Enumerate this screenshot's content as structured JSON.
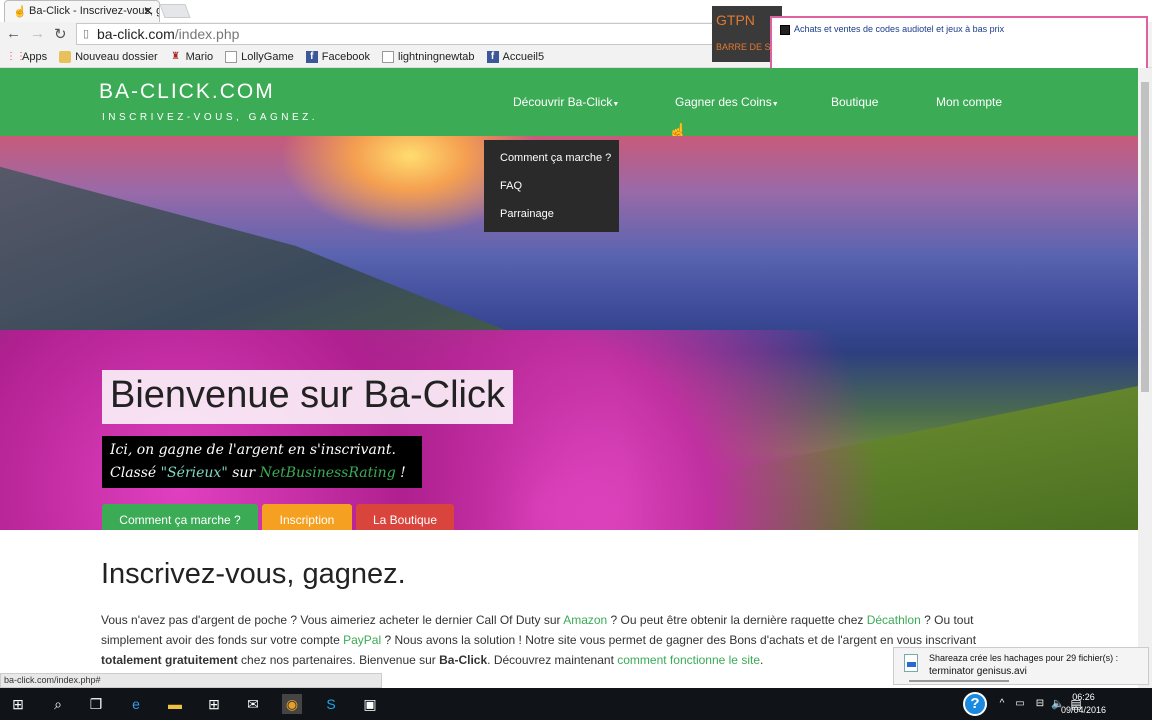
{
  "browser": {
    "tab_title": "Ba-Click - Inscrivez-vous, g",
    "url_domain": "ba-click.com",
    "url_path": "/index.php",
    "bookmarks": [
      "Apps",
      "Nouveau dossier",
      "Mario",
      "LollyGame",
      "Facebook",
      "lightningnewtab",
      "Accueil5"
    ]
  },
  "popup": {
    "side_title": "GTPN",
    "side_sub": "BARRE DE S",
    "message": "Achats et ventes de codes audiotel et jeux à bas prix"
  },
  "site": {
    "brand": "BA-CLICK.COM",
    "tagline": "INSCRIVEZ-VOUS, GAGNEZ.",
    "nav": [
      "Découvrir Ba-Click",
      "Gagner des Coins",
      "Boutique",
      "Mon compte"
    ],
    "dropdown": [
      "Comment ça marche ?",
      "FAQ",
      "Parrainage"
    ],
    "hero": {
      "title": "Bienvenue sur Ba-Click",
      "line1": "Ici, on gagne de l'argent en s'inscrivant.",
      "line2_a": "Classé ",
      "line2_b": "\"Sérieux\"",
      "line2_c": " sur ",
      "line2_d": "NetBusinessRating",
      "line2_e": " !",
      "buttons": [
        {
          "label": "Comment ça marche ?",
          "color": "#3bab55"
        },
        {
          "label": "Inscription",
          "color": "#f5a020"
        },
        {
          "label": "La Boutique",
          "color": "#d9443c"
        }
      ]
    },
    "section_title": "Inscrivez-vous, gagnez.",
    "para": {
      "t1": "Vous n'avez pas d'argent de poche ? Vous aimeriez acheter le dernier Call Of Duty sur ",
      "l1": "Amazon",
      "t2": " ? Ou peut être obtenir la dernière raquette chez ",
      "l2": "Décathlon",
      "t3": " ? Ou tout simplement avoir des fonds sur votre compte ",
      "l3": "PayPal",
      "t4": " ? Nous avons la solution ! Notre site vous permet de gagner des Bons d'achats et de l'argent en vous inscrivant ",
      "b1": "totalement gratuitement",
      "t5": " chez nos partenaires. Bienvenue sur ",
      "b2": "Ba-Click",
      "t6": ". Découvrez maintenant ",
      "l4": "comment fonctionne le site",
      "t7": "."
    }
  },
  "status_url": "ba-click.com/index.php#",
  "toast": {
    "line1": "Shareaza crée les hachages pour 29 fichier(s) :",
    "line2": "terminator genisus.avi"
  },
  "taskbar": {
    "time": "06:26",
    "date": "09/04/2016"
  }
}
